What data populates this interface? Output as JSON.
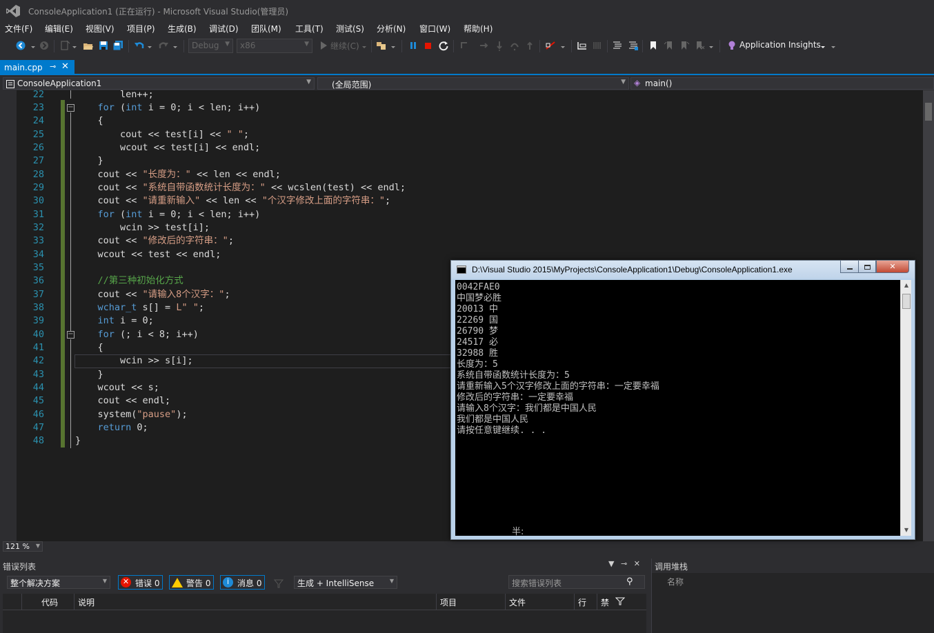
{
  "window": {
    "title": "ConsoleApplication1 (正在运行) - Microsoft Visual Studio(管理员)"
  },
  "menu": [
    "文件(F)",
    "编辑(E)",
    "视图(V)",
    "项目(P)",
    "生成(B)",
    "调试(D)",
    "团队(M)",
    "工具(T)",
    "测试(S)",
    "分析(N)",
    "窗口(W)",
    "帮助(H)"
  ],
  "toolbar": {
    "config": "Debug",
    "platform": "x86",
    "continue_label": "继续(C)",
    "insights_label": "Application Insights"
  },
  "tab": {
    "filename": "main.cpp",
    "pin": "⊸",
    "close": "✕"
  },
  "nav": {
    "project": "ConsoleApplication1",
    "scope": "(全局范围)",
    "member": "main()"
  },
  "editor": {
    "zoom": "121 %",
    "line_numbers": [
      "22",
      "23",
      "24",
      "25",
      "26",
      "27",
      "28",
      "29",
      "30",
      "31",
      "32",
      "33",
      "34",
      "35",
      "36",
      "37",
      "38",
      "39",
      "40",
      "41",
      "42",
      "43",
      "44",
      "45",
      "46",
      "47",
      "48"
    ]
  },
  "console": {
    "title": "D:\\Visual Studio 2015\\MyProjects\\ConsoleApplication1\\Debug\\ConsoleApplication1.exe",
    "output": [
      "0042FAE0",
      "中国梦必胜",
      "20013 中",
      "22269 国",
      "26790 梦",
      "24517 必",
      "32988 胜",
      "长度为：5",
      "系统自带函数统计长度为：5",
      "请重新输入5个汉字修改上面的字符串：一定要幸福",
      "修改后的字符串：一定要幸福",
      "请输入8个汉字：我们都是中国人民",
      "我们都是中国人民",
      "请按任意键继续. . ."
    ],
    "ime": "半:"
  },
  "error_list": {
    "title": "错误列表",
    "scope": "整个解决方案",
    "errors": "错误 0",
    "warnings": "警告 0",
    "messages": "消息 0",
    "build_filter": "生成 + IntelliSense",
    "search_placeholder": "搜索错误列表",
    "columns": [
      "代码",
      "说明",
      "项目",
      "文件",
      "行",
      "禁"
    ]
  },
  "call_stack": {
    "title": "调用堆栈",
    "column": "名称"
  },
  "colors": {
    "accent": "#007acc",
    "keyword": "#569cd6",
    "string": "#d69d85",
    "comment": "#57a64a",
    "line_number": "#2b91af"
  }
}
